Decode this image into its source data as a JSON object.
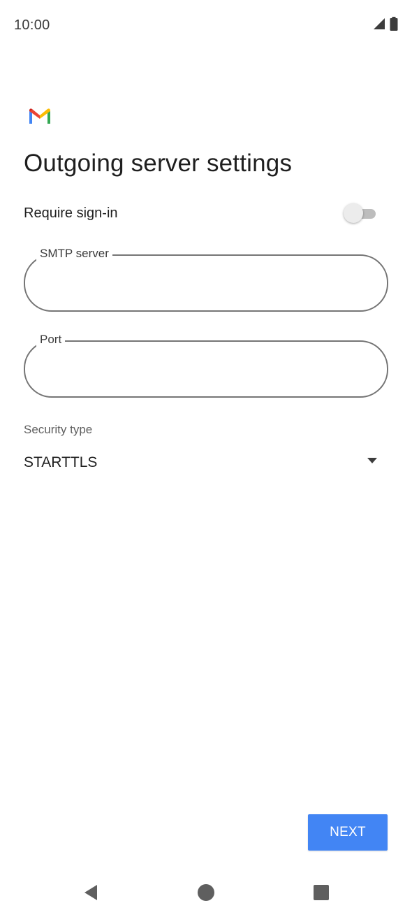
{
  "status_bar": {
    "time": "10:00",
    "icons": [
      "cellular-signal-icon",
      "battery-icon"
    ]
  },
  "app": {
    "logo": "gmail-logo"
  },
  "page": {
    "title": "Outgoing server settings"
  },
  "require_sign_in": {
    "label": "Require sign-in",
    "enabled": false
  },
  "fields": {
    "smtp_server": {
      "label": "SMTP server",
      "value": ""
    },
    "port": {
      "label": "Port",
      "value": ""
    }
  },
  "security": {
    "label": "Security type",
    "selected": "STARTTLS"
  },
  "actions": {
    "next_label": "NEXT"
  },
  "nav_bar": {
    "icons": [
      "back-icon",
      "home-icon",
      "recents-icon"
    ]
  },
  "colors": {
    "accent": "#4285f4",
    "outline": "#757575",
    "toggle_track_off": "#bdbdbd"
  }
}
